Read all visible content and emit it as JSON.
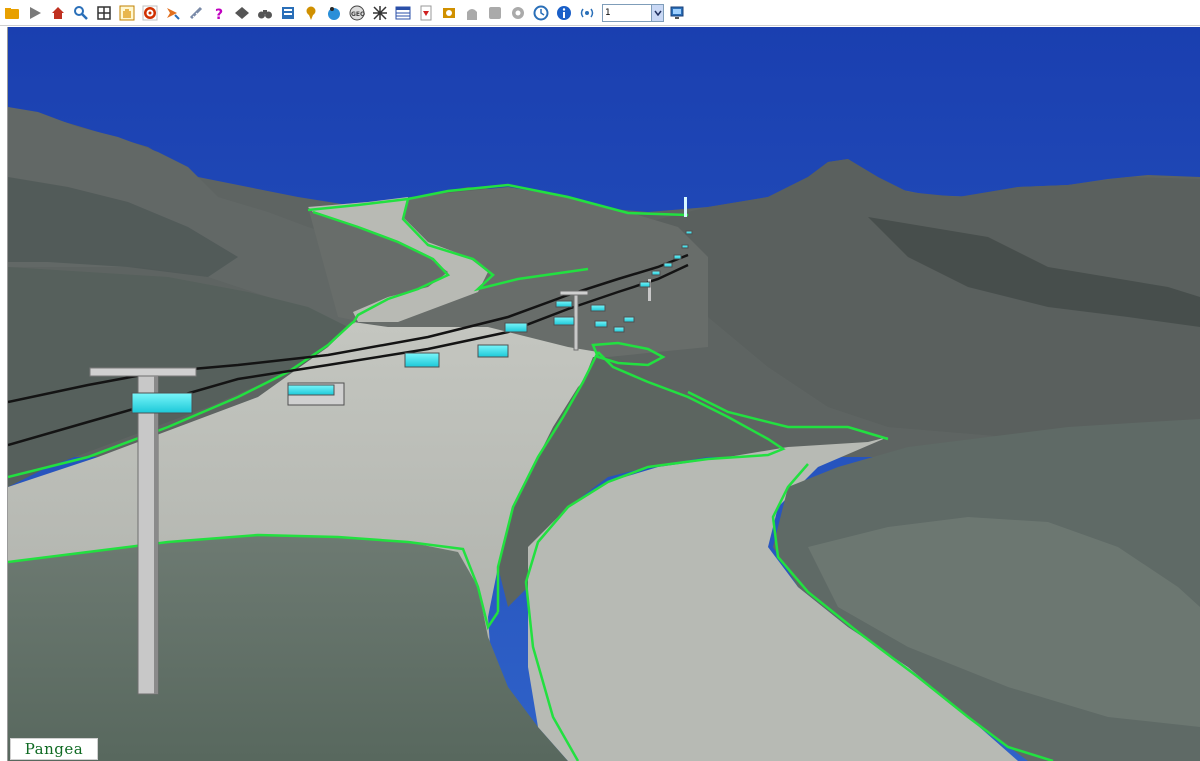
{
  "toolbar": {
    "tools": [
      {
        "name": "open-folder-icon",
        "color": "#e8a000"
      },
      {
        "name": "play-icon",
        "color": "#7a7a7a"
      },
      {
        "name": "home-icon",
        "color": "#c03020"
      },
      {
        "name": "zoom-icon",
        "color": "#2a6fb8"
      },
      {
        "name": "grid-icon",
        "color": "#333333"
      },
      {
        "name": "pan-hand-icon",
        "color": "#e0a020"
      },
      {
        "name": "target-icon",
        "color": "#d03000"
      },
      {
        "name": "fly-icon",
        "color": "#e07020"
      },
      {
        "name": "measure-icon",
        "color": "#7a8aa8"
      },
      {
        "name": "help-icon",
        "color": "#c000c0"
      },
      {
        "name": "layers-icon",
        "color": "#555555"
      },
      {
        "name": "binoculars-icon",
        "color": "#555555"
      },
      {
        "name": "properties-icon",
        "color": "#2a6fb8"
      },
      {
        "name": "pin-icon",
        "color": "#d09000"
      },
      {
        "name": "globe-walk-icon",
        "color": "#2a8fd8"
      },
      {
        "name": "geo-icon",
        "color": "#444444"
      },
      {
        "name": "network-icon",
        "color": "#333333"
      },
      {
        "name": "table-icon",
        "color": "#2a4fa8"
      },
      {
        "name": "pdf-icon",
        "color": "#d02020"
      },
      {
        "name": "stamp-icon",
        "color": "#d09000"
      },
      {
        "name": "tower-icon",
        "color": "#aaaaaa"
      },
      {
        "name": "box-icon",
        "color": "#aaaaaa"
      },
      {
        "name": "settings-icon",
        "color": "#aaaaaa"
      },
      {
        "name": "clock-icon",
        "color": "#2a6fb8"
      },
      {
        "name": "info-icon",
        "color": "#1a5fc8"
      },
      {
        "name": "broadcast-icon",
        "color": "#2a6fb8"
      }
    ],
    "layer_select": {
      "value": "1"
    },
    "monitor": {
      "name": "monitor-icon",
      "color": "#2a6fb8"
    }
  },
  "viewport": {
    "sky_color": "#1f48b8",
    "piste_outline_color": "#22e040",
    "cabin_color": "#2be8f0"
  },
  "logo": {
    "text": "Pangea"
  }
}
